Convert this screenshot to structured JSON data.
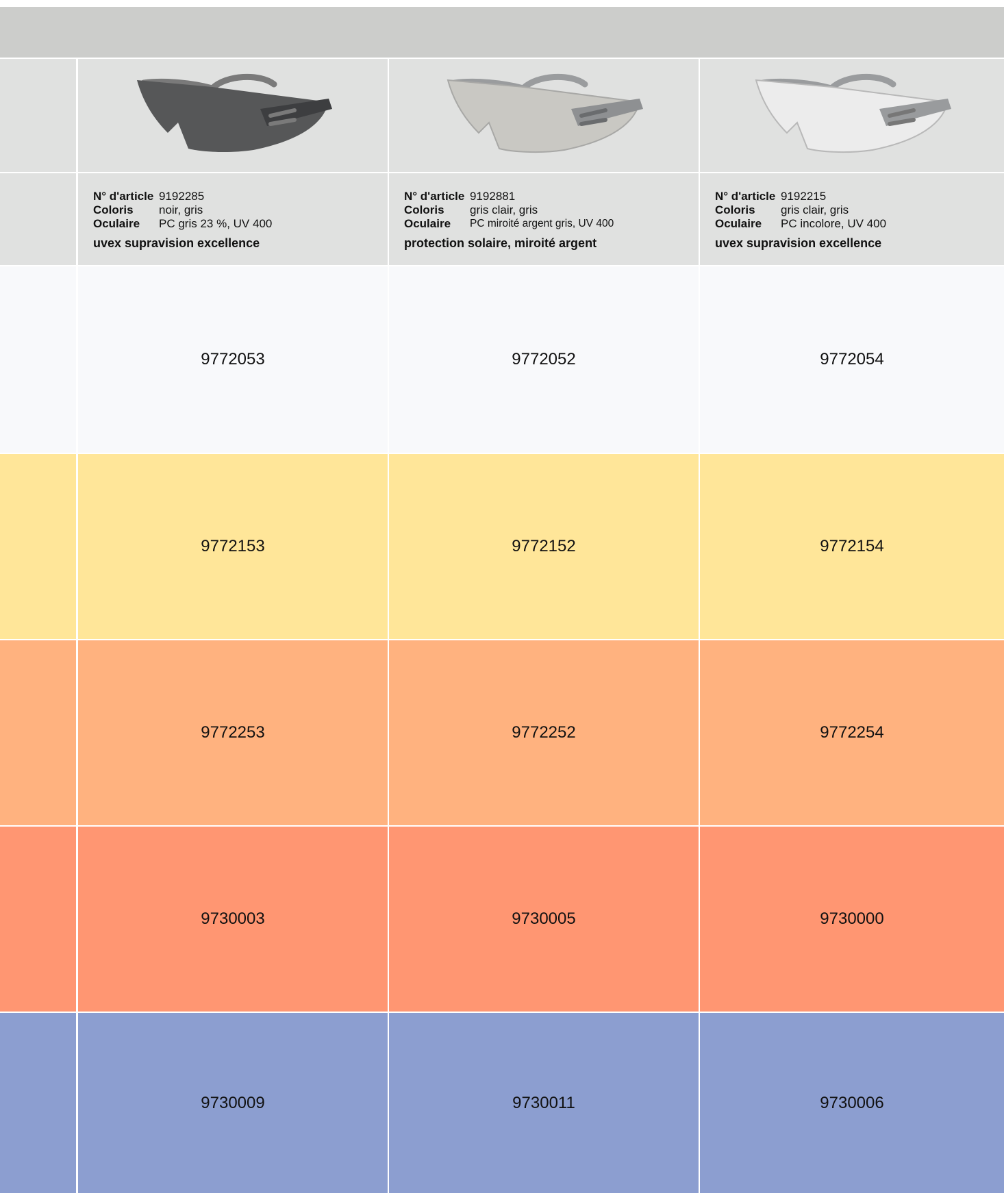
{
  "products": [
    {
      "article_label": "N° d'article",
      "article_no": "9192285",
      "colors_label": "Coloris",
      "colors": "noir, gris",
      "lens_label": "Oculaire",
      "lens": "PC gris 23 %, UV 400",
      "description": "uvex supravision excellence",
      "image": "safety-glasses-grey-lens"
    },
    {
      "article_label": "N° d'article",
      "article_no": "9192881",
      "colors_label": "Coloris",
      "colors": "gris clair, gris",
      "lens_label": "Oculaire",
      "lens": "PC miroité argent gris, UV 400",
      "description": "protection solaire, miroité argent",
      "image": "safety-glasses-silver-mirror-lens"
    },
    {
      "article_label": "N° d'article",
      "article_no": "9192215",
      "colors_label": "Coloris",
      "colors": "gris clair, gris",
      "lens_label": "Oculaire",
      "lens": "PC incolore, UV 400",
      "description": "uvex supravision excellence",
      "image": "safety-glasses-clear-lens"
    }
  ],
  "rows": [
    {
      "color": "#f8f9fb",
      "codes": [
        "9772053",
        "9772052",
        "9772054"
      ]
    },
    {
      "color": "#ffe699",
      "codes": [
        "9772153",
        "9772152",
        "9772154"
      ]
    },
    {
      "color": "#ffb27f",
      "codes": [
        "9772253",
        "9772252",
        "9772254"
      ]
    },
    {
      "color": "#ff9672",
      "codes": [
        "9730003",
        "9730005",
        "9730000"
      ]
    },
    {
      "color": "#8c9ed0",
      "codes": [
        "9730009",
        "9730011",
        "9730006"
      ]
    }
  ]
}
